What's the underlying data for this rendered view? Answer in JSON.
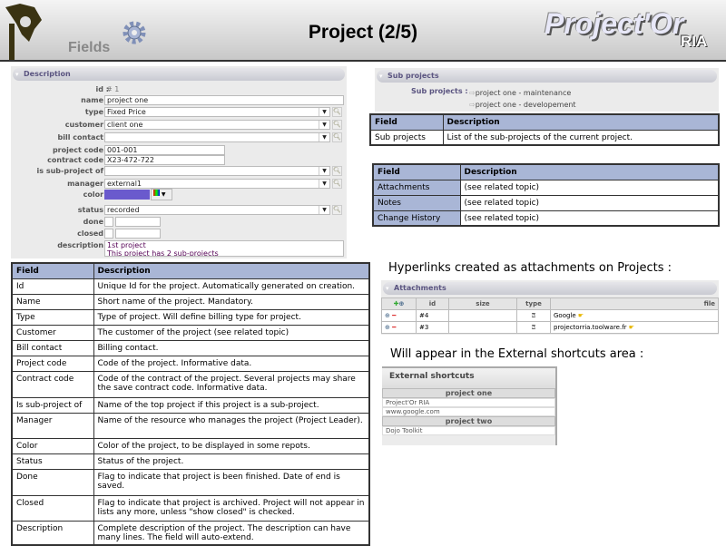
{
  "header": {
    "section": "Fields",
    "title": "Project (2/5)",
    "brand": "Project'Or",
    "brand_sub": "RIA"
  },
  "form": {
    "panel_title": "Description",
    "fields": [
      {
        "label": "id :",
        "value": "# 1",
        "kind": "text"
      },
      {
        "label": "name :",
        "value": "project one",
        "kind": "input"
      },
      {
        "label": "type :",
        "value": "Fixed Price",
        "kind": "select"
      },
      {
        "label": "customer :",
        "value": "client one",
        "kind": "select"
      },
      {
        "label": "bill contact :",
        "value": "",
        "kind": "select"
      },
      {
        "label": "project code :",
        "value": "001-001",
        "kind": "short"
      },
      {
        "label": "contract code :",
        "value": "X23-472-722",
        "kind": "short"
      },
      {
        "label": "is sub-project of :",
        "value": "",
        "kind": "select"
      },
      {
        "label": "manager :",
        "value": "external1",
        "kind": "select"
      },
      {
        "label": "color :",
        "value": "#6a5acd",
        "kind": "color"
      },
      {
        "label": "status :",
        "value": "recorded",
        "kind": "select"
      },
      {
        "label": "done :",
        "value": "",
        "kind": "check"
      },
      {
        "label": "closed :",
        "value": "",
        "kind": "check"
      }
    ],
    "description_label": "description :",
    "description_lines": [
      "1st project",
      "This project has 2 sub-projects"
    ]
  },
  "main_table": {
    "headers": [
      "Field",
      "Description"
    ],
    "rows": [
      [
        "Id",
        "Unique Id for the project. Automatically generated on creation."
      ],
      [
        "Name",
        "Short name of the project. Mandatory."
      ],
      [
        "Type",
        "Type of project. Will define billing type for project."
      ],
      [
        "Customer",
        "The customer of the project (see related topic)"
      ],
      [
        "Bill contact",
        "Billing contact."
      ],
      [
        "Project code",
        "Code of the project. Informative data."
      ],
      [
        "Contract code",
        "Code of the contract of the project. Several projects may share the save contract code. Informative data."
      ],
      [
        "Is sub-project of",
        "Name of the top project if this project is a sub-project."
      ],
      [
        "Manager",
        "Name of the resource who manages the project (Project Leader)."
      ],
      [
        "Color",
        "Color of the project, to be displayed in some repots."
      ],
      [
        "Status",
        "Status of the project."
      ],
      [
        "Done",
        "Flag to indicate that project is been finished. Date of end is saved."
      ],
      [
        "Closed",
        "Flag to indicate that project is archived. Project will not appear in lists any more, unless \"show closed\" is checked."
      ],
      [
        "Description",
        "Complete description of the project. The description can have many lines. The field will auto-extend."
      ]
    ]
  },
  "subprojects": {
    "panel_title": "Sub projects",
    "label": "Sub projects :",
    "items": [
      "project one - maintenance",
      "project one - developement"
    ]
  },
  "sub_table": {
    "headers": [
      "Field",
      "Description"
    ],
    "rows": [
      [
        "Sub projects",
        "List of the sub-projects of the current project."
      ]
    ]
  },
  "related_table": {
    "headers": [
      "Field",
      "Description"
    ],
    "rows": [
      [
        "Attachments",
        "(see related topic)"
      ],
      [
        "Notes",
        "(see related topic)"
      ],
      [
        "Change History",
        "(see related topic)"
      ]
    ]
  },
  "hyperlinks_text": "Hyperlinks created as attachments on Projects :",
  "attachments": {
    "panel_title": "Attachments",
    "headers": [
      "id",
      "size",
      "type",
      "file"
    ],
    "rows": [
      {
        "id": "#4",
        "size": "",
        "file": "Google"
      },
      {
        "id": "#3",
        "size": "",
        "file": "projectorria.toolware.fr"
      }
    ]
  },
  "appear_text": "Will appear in the External shortcuts area :",
  "shortcuts": {
    "title": "External shortcuts",
    "groups": [
      {
        "name": "project one",
        "items": [
          "Project'Or RIA",
          "www.google.com"
        ]
      },
      {
        "name": "project two",
        "items": [
          "Dojo Toolkit"
        ]
      }
    ]
  },
  "colors": {
    "table_header": "#a9b6d6",
    "panel_title": "#5a5480"
  }
}
